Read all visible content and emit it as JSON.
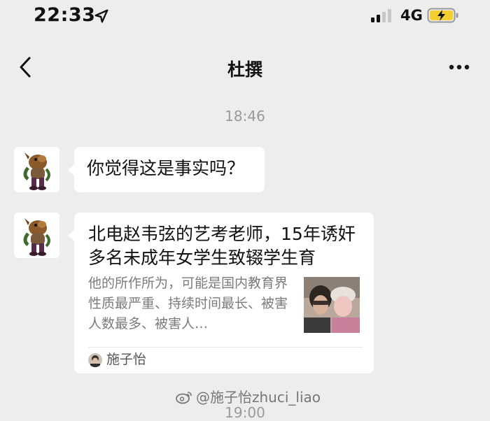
{
  "status_bar": {
    "time": "22:33",
    "network": "4G",
    "icons": [
      "location-arrow-icon",
      "signal-bars-icon",
      "battery-charging-icon"
    ],
    "battery_color": "#f5cf2d"
  },
  "nav": {
    "title": "杜撰",
    "back_icon": "chevron-left-icon",
    "more_icon": "more-dots-icon"
  },
  "chat": {
    "timestamp": "18:46",
    "messages": [
      {
        "type": "text",
        "text": "你觉得这是事实吗？"
      },
      {
        "type": "article-card",
        "title": "北电赵韦弦的艺考老师，15年诱奸多名未成年女学生致辍学生育",
        "description": "他的所作所为，可能是国内教育界性质最严重、持续时间最长、被害人数最多、被害人…",
        "source": "施子怡"
      }
    ],
    "next_timestamp_partial": "19:00"
  },
  "watermark": {
    "text": "@施子怡zhuci_liao",
    "icon": "weibo-icon"
  },
  "colors": {
    "background": "#ededed",
    "bubble": "#ffffff",
    "muted_text": "#9a9a9a",
    "description_text": "#7b7b7b"
  }
}
